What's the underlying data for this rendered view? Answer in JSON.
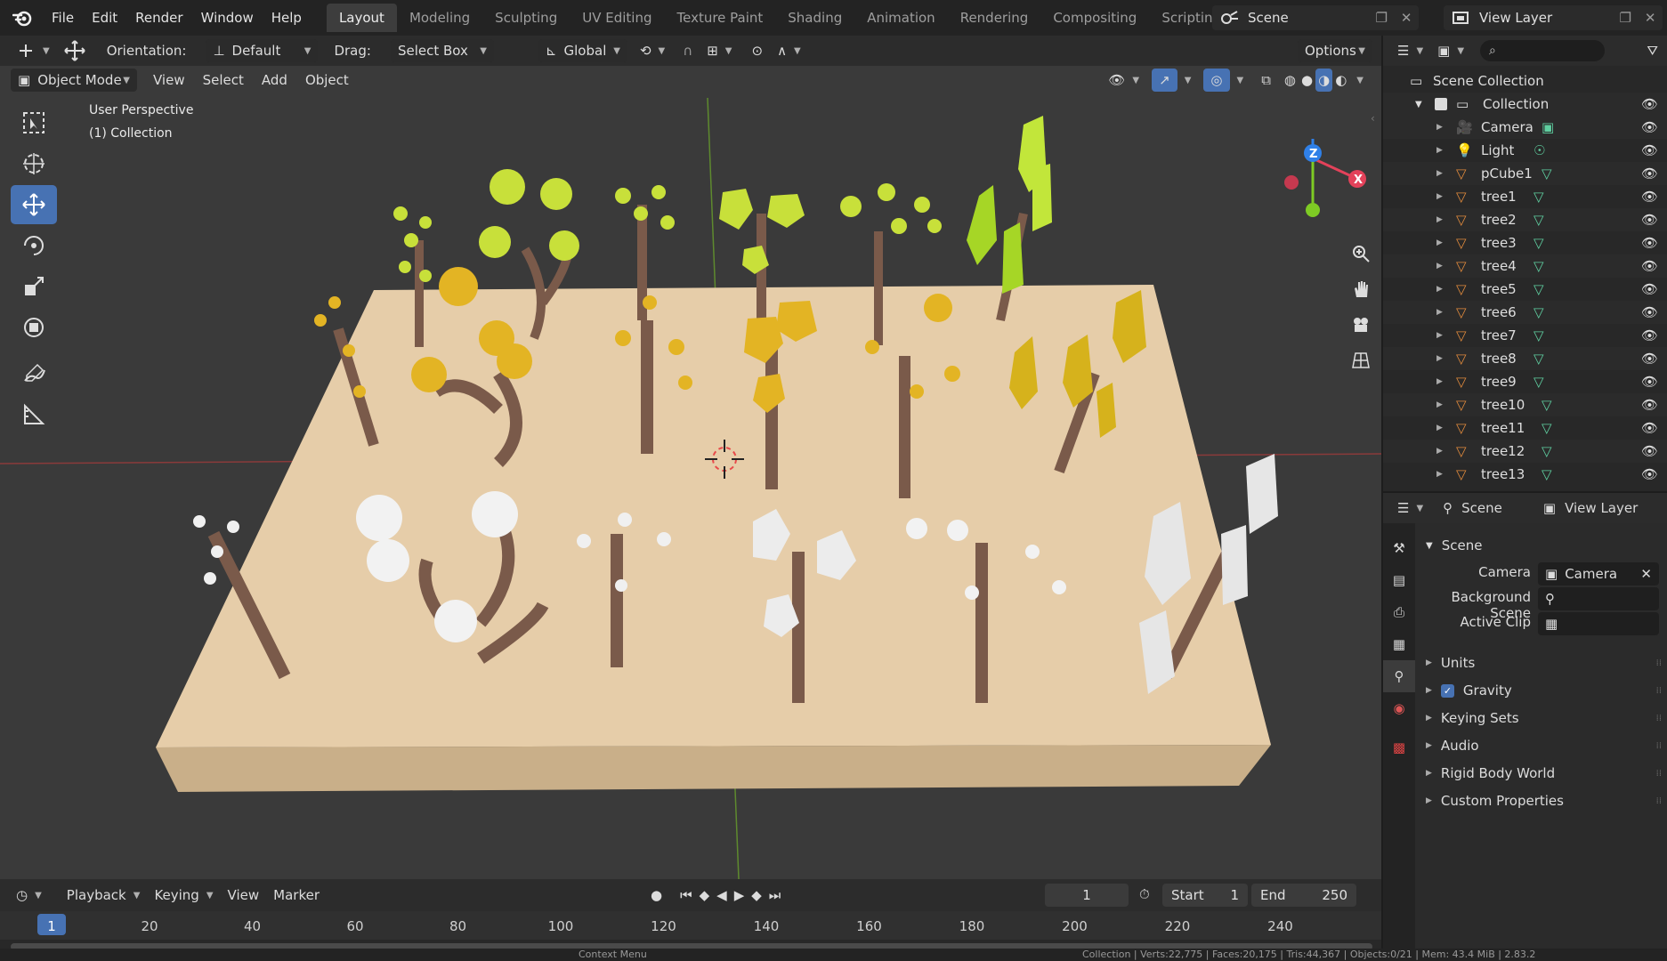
{
  "topbar": {
    "menus": [
      "File",
      "Edit",
      "Render",
      "Window",
      "Help"
    ],
    "workspaces": [
      "Layout",
      "Modeling",
      "Sculpting",
      "UV Editing",
      "Texture Paint",
      "Shading",
      "Animation",
      "Rendering",
      "Compositing",
      "Scripting"
    ],
    "active_workspace": "Layout",
    "add_symbol": "+",
    "scene_name": "Scene",
    "view_layer_name": "View Layer"
  },
  "viewport": {
    "header": {
      "orientation_label": "Orientation:",
      "orientation_value": "Default",
      "drag_label": "Drag:",
      "drag_value": "Select Box",
      "transform_space": "Global",
      "options_label": "Options"
    },
    "header2": {
      "mode": "Object Mode",
      "menus": [
        "View",
        "Select",
        "Add",
        "Object"
      ]
    },
    "perspective_text": "User Perspective",
    "collection_text": "(1) Collection",
    "gizmo": {
      "x_color": "#e3425a",
      "y_color": "#7ecb24",
      "z_color": "#2f80e8",
      "z_label": "Z",
      "x_label": "X"
    }
  },
  "outliner": {
    "root": "Scene Collection",
    "collection": "Collection",
    "items": [
      {
        "name": "Camera",
        "type": "camera"
      },
      {
        "name": "Light",
        "type": "light"
      },
      {
        "name": "pCube1",
        "type": "mesh"
      },
      {
        "name": "tree1",
        "type": "mesh"
      },
      {
        "name": "tree2",
        "type": "mesh"
      },
      {
        "name": "tree3",
        "type": "mesh"
      },
      {
        "name": "tree4",
        "type": "mesh"
      },
      {
        "name": "tree5",
        "type": "mesh"
      },
      {
        "name": "tree6",
        "type": "mesh"
      },
      {
        "name": "tree7",
        "type": "mesh"
      },
      {
        "name": "tree8",
        "type": "mesh"
      },
      {
        "name": "tree9",
        "type": "mesh"
      },
      {
        "name": "tree10",
        "type": "mesh"
      },
      {
        "name": "tree11",
        "type": "mesh"
      },
      {
        "name": "tree12",
        "type": "mesh"
      },
      {
        "name": "tree13",
        "type": "mesh"
      }
    ]
  },
  "properties": {
    "header_scene": "Scene",
    "header_view_layer": "View Layer",
    "panel_title": "Scene",
    "camera_label": "Camera",
    "camera_value": "Camera",
    "background_scene_label": "Background Scene",
    "active_clip_label": "Active Clip",
    "subpanels": [
      "Units",
      "Gravity",
      "Keying Sets",
      "Audio",
      "Rigid Body World",
      "Custom Properties"
    ]
  },
  "timeline": {
    "menus": [
      "Playback",
      "Keying",
      "View",
      "Marker"
    ],
    "current_frame": "1",
    "start_label": "Start",
    "start_value": "1",
    "end_label": "End",
    "end_value": "250",
    "ruler": [
      "1",
      "20",
      "40",
      "60",
      "80",
      "100",
      "120",
      "140",
      "160",
      "180",
      "200",
      "220",
      "240"
    ]
  },
  "statusbar": {
    "center": "Context Menu",
    "right": "Collection | Verts:22,775 | Faces:20,175 | Tris:44,367 | Objects:0/21 | Mem: 43.4 MiB | 2.83.2"
  }
}
